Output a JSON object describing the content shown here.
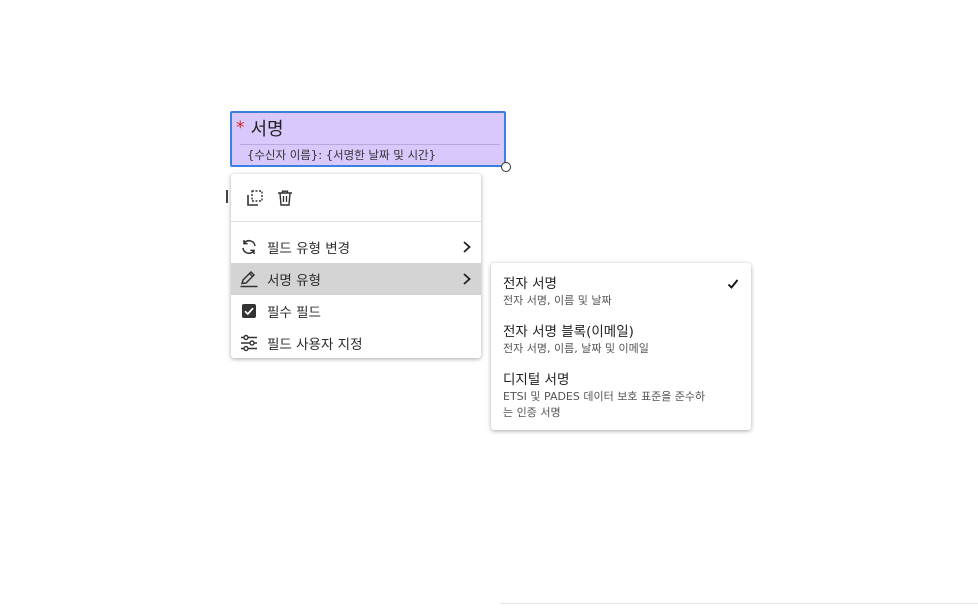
{
  "field": {
    "required_mark": "*",
    "title": "서명",
    "subtitle": "{수신자 이름}: {서명한 날짜 및 시간}"
  },
  "context_menu": {
    "items": [
      {
        "label": "필드 유형 변경",
        "icon": "refresh-icon",
        "has_submenu": true
      },
      {
        "label": "서명 유형",
        "icon": "pen-edit-icon",
        "has_submenu": true,
        "active": true
      },
      {
        "label": "필수 필드",
        "icon": "checkbox-checked-icon",
        "has_submenu": false,
        "checked": true
      },
      {
        "label": "필드 사용자 지정",
        "icon": "sliders-icon",
        "has_submenu": false
      }
    ]
  },
  "submenu": {
    "items": [
      {
        "title": "전자 서명",
        "description": "전자 서명, 이름 및 날짜",
        "selected": true
      },
      {
        "title": "전자 서명 블록(이메일)",
        "description": "전자 서명, 이름, 날짜 및 이메일",
        "selected": false
      },
      {
        "title": "디지털 서명",
        "description": "ETSI 및 PADES 데이터 보호 표준을 준수하는 인증 서명",
        "selected": false
      }
    ]
  },
  "colors": {
    "field_fill": "#d8c8fb",
    "field_border": "#3d7fe0",
    "required_mark": "#d7261e",
    "active_row": "#d4d4d4"
  }
}
